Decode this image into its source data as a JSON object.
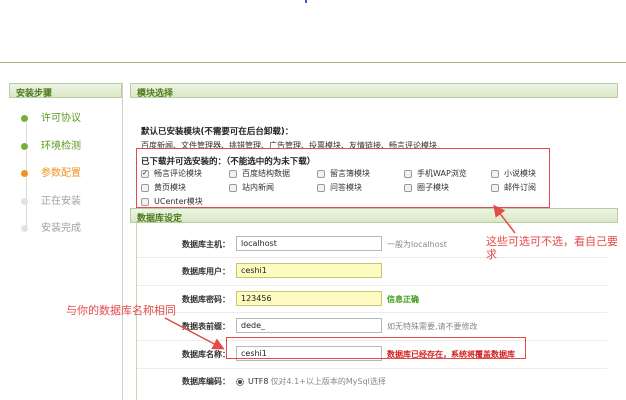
{
  "sidebar": {
    "title": "安装步骤",
    "steps": [
      {
        "label": "许可协议",
        "state": "done"
      },
      {
        "label": "环境检测",
        "state": "done"
      },
      {
        "label": "参数配置",
        "state": "current"
      },
      {
        "label": "正在安装",
        "state": "todo"
      },
      {
        "label": "安装完成",
        "state": "todo"
      }
    ]
  },
  "modules": {
    "title": "模块选择",
    "default_installed_heading": "默认已安装模块(不需要可在后台卸载)：",
    "default_installed_list": "百度新闻、文件管理器、挑错管理、广告管理、投票模块、友情链接、畅言评论模块",
    "optional_heading": "已下载并可选安装的：（不能选中的为未下载）",
    "items": [
      {
        "label": "畅言评论模块",
        "checked": true
      },
      {
        "label": "百度结构数据",
        "checked": false
      },
      {
        "label": "留言簿模块",
        "checked": false
      },
      {
        "label": "手机WAP浏览",
        "checked": false
      },
      {
        "label": "小说模块",
        "checked": false
      },
      {
        "label": "黄页模块",
        "checked": false
      },
      {
        "label": "站内新闻",
        "checked": false
      },
      {
        "label": "问答模块",
        "checked": false
      },
      {
        "label": "圈子模块",
        "checked": false
      },
      {
        "label": "邮件订阅",
        "checked": false
      },
      {
        "label": "UCenter模块",
        "checked": false
      }
    ]
  },
  "database": {
    "title": "数据库设定",
    "host": {
      "label": "数据库主机：",
      "value": "localhost",
      "hint": "一般为localhost"
    },
    "user": {
      "label": "数据库用户：",
      "value": "ceshi1"
    },
    "password": {
      "label": "数据库密码：",
      "value": "123456",
      "hint": "信息正确"
    },
    "prefix": {
      "label": "数据表前缀：",
      "value": "dede_",
      "hint": "如无特殊需要,请不要修改"
    },
    "name": {
      "label": "数据库名称：",
      "value": "ceshi1",
      "hint": "数据库已经存在，系统将覆盖数据库"
    },
    "charset": {
      "label": "数据库编码：",
      "option": "UTF8",
      "note": "仅对4.1+以上版本的MySql选择"
    }
  },
  "annotations": {
    "optional": "这些可选可不选，看自己要求",
    "dbname": "与你的数据库名称相同"
  },
  "colors": {
    "accent_green": "#77b034",
    "current_orange": "#f29422",
    "annotation_red": "#e34a4a",
    "ok_green": "#3a9a12",
    "input_yellow": "#fdfbc0"
  }
}
